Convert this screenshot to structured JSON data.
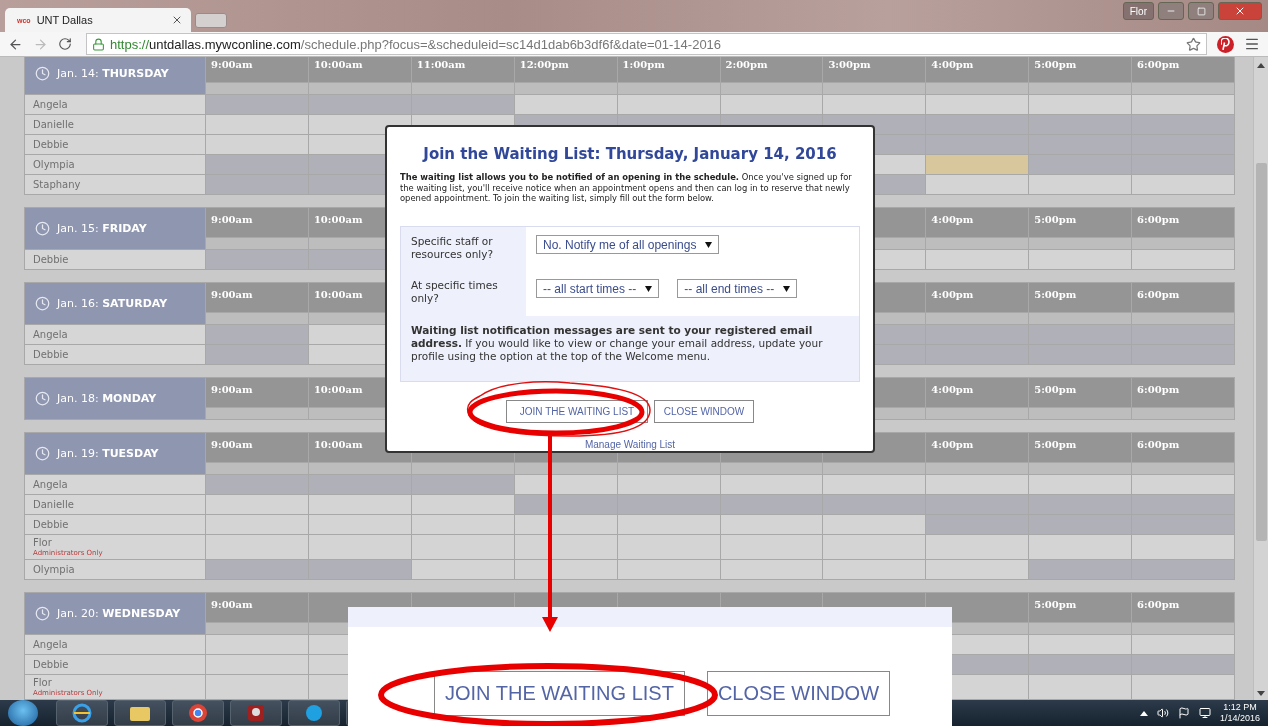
{
  "browser": {
    "tab": {
      "favicon_text": "wco",
      "title": "UNT Dallas"
    },
    "profile": "Flor",
    "url": {
      "scheme": "https://",
      "host": "untdallas.mywconline.com",
      "path": "/schedule.php?focus=&scheduleid=sc14d1dab6b3df6f&date=01-14-2016"
    }
  },
  "schedule": {
    "days": [
      {
        "label": "Jan. 14: **THURSDAY**",
        "times_left": [
          "9:00am",
          "10:00am",
          "11:00am",
          "12:00pm",
          "1:00pm",
          "2:00pm",
          "3:00pm",
          "4:00pm",
          "5:00pm",
          "6:00pm"
        ],
        "rows": [
          {
            "name": "Angela",
            "slots": [
              {
                "kind": "booked"
              },
              {
                "kind": "booked"
              },
              {
                "kind": "booked"
              },
              {
                "kind": "open"
              },
              {
                "kind": "open"
              },
              {
                "kind": "open"
              },
              {
                "kind": "open"
              },
              {
                "kind": "open"
              },
              {
                "kind": "open"
              },
              {
                "kind": "open"
              }
            ]
          },
          {
            "name": "Danielle",
            "slots": [
              {
                "kind": "open"
              },
              {
                "kind": "open"
              },
              {
                "kind": "open"
              },
              {
                "kind": "booked"
              },
              {
                "kind": "booked"
              },
              {
                "kind": "booked"
              },
              {
                "kind": "booked"
              },
              {
                "kind": "booked"
              },
              {
                "kind": "booked"
              },
              {
                "kind": "booked"
              }
            ]
          },
          {
            "name": "Debbie",
            "slots_left": [
              {
                "kind": "open"
              },
              {
                "kind": "open"
              }
            ],
            "slots_right": [
              {
                "kind": "booked"
              },
              {
                "kind": "booked"
              },
              {
                "kind": "booked"
              },
              {
                "kind": "booked"
              }
            ]
          },
          {
            "name": "Olympia",
            "slots_left": [
              {
                "kind": "booked"
              },
              {
                "kind": "booked"
              }
            ],
            "slots_right": [
              {
                "kind": "open"
              },
              {
                "kind": "held"
              },
              {
                "kind": "booked"
              },
              {
                "kind": "booked"
              }
            ]
          },
          {
            "name": "Staphany",
            "slots_left": [
              {
                "kind": "booked"
              },
              {
                "kind": "booked"
              }
            ],
            "slots_right": [
              {
                "kind": "booked"
              },
              {
                "kind": "open"
              },
              {
                "kind": "open"
              },
              {
                "kind": "open"
              }
            ]
          }
        ]
      },
      {
        "label": "Jan. 15: **FRIDAY**",
        "times_left": [
          "9:00am",
          "10:00am"
        ],
        "times_right": [
          "4:00pm",
          "5:00pm",
          "6:00pm"
        ],
        "rows": [
          {
            "name": "Debbie",
            "slots_left": [
              {
                "kind": "booked"
              },
              {
                "kind": "booked"
              }
            ],
            "slots_right": [
              {
                "kind": "open"
              },
              {
                "kind": "open"
              },
              {
                "kind": "open"
              },
              {
                "kind": "open"
              }
            ]
          }
        ]
      },
      {
        "label": "Jan. 16: **SATURDAY**",
        "times_left": [
          "9:00am",
          "10:00am"
        ],
        "times_right": [
          "4:00pm",
          "5:00pm",
          "6:00pm"
        ],
        "rows": [
          {
            "name": "Angela",
            "slots_left": [
              {
                "kind": "booked"
              },
              {
                "kind": "open"
              }
            ],
            "slots_right": [
              {
                "kind": "booked"
              },
              {
                "kind": "booked"
              },
              {
                "kind": "booked"
              },
              {
                "kind": "booked"
              }
            ]
          },
          {
            "name": "Debbie",
            "slots_left": [
              {
                "kind": "booked"
              },
              {
                "kind": "open"
              }
            ],
            "slots_right": [
              {
                "kind": "booked"
              },
              {
                "kind": "booked"
              },
              {
                "kind": "booked"
              },
              {
                "kind": "booked"
              }
            ]
          }
        ]
      },
      {
        "label": "Jan. 18: **MONDAY**",
        "times_left": [
          "9:00am",
          "10:00am"
        ],
        "times_right": [
          "4:00pm",
          "5:00pm",
          "6:00pm"
        ]
      },
      {
        "label": "Jan. 19: **TUESDAY**",
        "times_left": [
          "9:00am",
          "10:00am"
        ],
        "times_right": [
          "4:00pm",
          "5:00pm",
          "6:00pm"
        ],
        "rows": [
          {
            "name": "Angela",
            "slots": [
              {
                "kind": "booked"
              },
              {
                "kind": "booked"
              },
              {
                "kind": "booked"
              },
              {
                "kind": "open"
              },
              {
                "kind": "open"
              },
              {
                "kind": "open"
              },
              {
                "kind": "open"
              },
              {
                "kind": "open"
              },
              {
                "kind": "open"
              },
              {
                "kind": "open"
              }
            ]
          },
          {
            "name": "Danielle",
            "slots": [
              {
                "kind": "open"
              },
              {
                "kind": "open"
              },
              {
                "kind": "open"
              },
              {
                "kind": "booked"
              },
              {
                "kind": "booked"
              },
              {
                "kind": "booked"
              },
              {
                "kind": "booked"
              },
              {
                "kind": "booked"
              },
              {
                "kind": "booked"
              },
              {
                "kind": "booked"
              }
            ]
          },
          {
            "name": "Debbie",
            "slots": [
              {
                "kind": "open"
              },
              {
                "kind": "open"
              },
              {
                "kind": "open"
              },
              {
                "kind": "open"
              },
              {
                "kind": "open"
              },
              {
                "kind": "open"
              },
              {
                "kind": "open"
              },
              {
                "kind": "booked"
              },
              {
                "kind": "booked"
              },
              {
                "kind": "booked"
              }
            ]
          },
          {
            "name": "Flor",
            "note": "Administrators Only",
            "slots": [
              {
                "kind": "open"
              },
              {
                "kind": "open"
              },
              {
                "kind": "open"
              },
              {
                "kind": "open"
              },
              {
                "kind": "open"
              },
              {
                "kind": "open"
              },
              {
                "kind": "open"
              },
              {
                "kind": "open"
              },
              {
                "kind": "open"
              },
              {
                "kind": "open"
              }
            ]
          },
          {
            "name": "Olympia",
            "slots": [
              {
                "kind": "booked"
              },
              {
                "kind": "booked"
              },
              {
                "kind": "open"
              },
              {
                "kind": "open"
              },
              {
                "kind": "open"
              },
              {
                "kind": "open"
              },
              {
                "kind": "open"
              },
              {
                "kind": "open"
              },
              {
                "kind": "booked"
              },
              {
                "kind": "booked"
              }
            ]
          }
        ]
      },
      {
        "label": "Jan. 20: **WEDNESDAY**",
        "times_left": [
          "9:00am"
        ],
        "times_right": [
          "5:00pm",
          "6:00pm"
        ],
        "rows": [
          {
            "name": "Angela",
            "slots_left": [
              {
                "kind": "open"
              },
              {
                "kind": "open"
              }
            ],
            "slots_right": [
              {
                "kind": "open"
              },
              {
                "kind": "open"
              },
              {
                "kind": "open"
              }
            ]
          },
          {
            "name": "Debbie",
            "slots_left": [
              {
                "kind": "open"
              },
              {
                "kind": "open"
              }
            ],
            "slots_right": [
              {
                "kind": "booked"
              },
              {
                "kind": "booked"
              },
              {
                "kind": "booked"
              }
            ]
          },
          {
            "name": "Flor",
            "note": "Administrators Only",
            "slots_left": [
              {
                "kind": "open"
              },
              {
                "kind": "open"
              }
            ],
            "slots_right": [
              {
                "kind": "open"
              },
              {
                "kind": "open"
              },
              {
                "kind": "open"
              }
            ]
          }
        ]
      }
    ]
  },
  "dialog": {
    "title": "Join the Waiting List: Thursday, January 14, 2016",
    "intro": "**The waiting list allows you to be notified of an opening in the schedule.** Once you've signed up for the waiting list, you'll receive notice when an appointment opens and then can log in to reserve that newly opened appointment. To join the waiting list, simply fill out the form below.",
    "fields": [
      {
        "label": "Specific staff or resources only?",
        "selects": [
          "No. Notify me of all openings"
        ]
      },
      {
        "label": "At specific times only?",
        "selects": [
          "-- all start times --",
          "-- all end times --"
        ]
      }
    ],
    "notice": "**Waiting list notification messages are sent to your registered email address.** If you would like to view or change your email address, update your profile using the option at the top of the Welcome menu.",
    "buttons": [
      "JOIN THE WAITING LIST",
      "CLOSE WINDOW"
    ],
    "link": "Manage Waiting List"
  },
  "zoom_inset": {
    "buttons": [
      "JOIN THE WAITING LIST",
      "CLOSE WINDOW"
    ]
  },
  "taskbar": {
    "time": "1:12 PM",
    "date": "1/14/2016"
  }
}
